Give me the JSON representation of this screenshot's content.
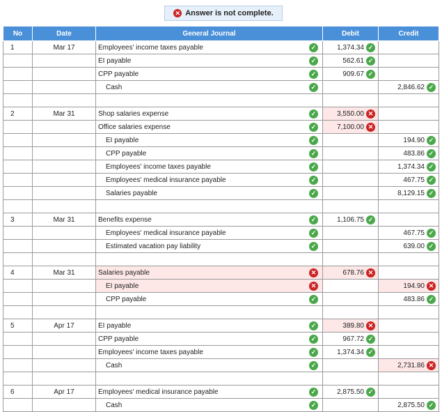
{
  "banner": "Answer is not complete.",
  "headers": [
    "No",
    "Date",
    "General Journal",
    "Debit",
    "Credit"
  ],
  "rows": [
    {
      "no": "1",
      "date": "Mar 17",
      "account": "Employees' income taxes payable",
      "indent": false,
      "acc_ok": true,
      "debit": "1,374.34",
      "debit_ok": true,
      "credit": "",
      "credit_ok": null
    },
    {
      "no": "",
      "date": "",
      "account": "EI payable",
      "indent": false,
      "acc_ok": true,
      "debit": "562.61",
      "debit_ok": true,
      "credit": "",
      "credit_ok": null
    },
    {
      "no": "",
      "date": "",
      "account": "CPP payable",
      "indent": false,
      "acc_ok": true,
      "debit": "909.67",
      "debit_ok": true,
      "credit": "",
      "credit_ok": null
    },
    {
      "no": "",
      "date": "",
      "account": "Cash",
      "indent": true,
      "acc_ok": true,
      "debit": "",
      "debit_ok": null,
      "credit": "2,846.62",
      "credit_ok": true
    },
    {
      "gap": true
    },
    {
      "no": "2",
      "date": "Mar 31",
      "account": "Shop salaries expense",
      "indent": false,
      "acc_ok": true,
      "debit": "3,550.00",
      "debit_ok": false,
      "credit": "",
      "credit_ok": null
    },
    {
      "no": "",
      "date": "",
      "account": "Office salaries expense",
      "indent": false,
      "acc_ok": true,
      "debit": "7,100.00",
      "debit_ok": false,
      "credit": "",
      "credit_ok": null
    },
    {
      "no": "",
      "date": "",
      "account": "EI payable",
      "indent": true,
      "acc_ok": true,
      "debit": "",
      "debit_ok": null,
      "credit": "194.90",
      "credit_ok": true
    },
    {
      "no": "",
      "date": "",
      "account": "CPP payable",
      "indent": true,
      "acc_ok": true,
      "debit": "",
      "debit_ok": null,
      "credit": "483.86",
      "credit_ok": true
    },
    {
      "no": "",
      "date": "",
      "account": "Employees' income taxes payable",
      "indent": true,
      "acc_ok": true,
      "debit": "",
      "debit_ok": null,
      "credit": "1,374.34",
      "credit_ok": true
    },
    {
      "no": "",
      "date": "",
      "account": "Employees' medical insurance payable",
      "indent": true,
      "acc_ok": true,
      "debit": "",
      "debit_ok": null,
      "credit": "467.75",
      "credit_ok": true
    },
    {
      "no": "",
      "date": "",
      "account": "Salaries payable",
      "indent": true,
      "acc_ok": true,
      "debit": "",
      "debit_ok": null,
      "credit": "8,129.15",
      "credit_ok": true
    },
    {
      "gap": true
    },
    {
      "no": "3",
      "date": "Mar 31",
      "account": "Benefits expense",
      "indent": false,
      "acc_ok": true,
      "debit": "1,106.75",
      "debit_ok": true,
      "credit": "",
      "credit_ok": null
    },
    {
      "no": "",
      "date": "",
      "account": "Employees' medical insurance payable",
      "indent": true,
      "acc_ok": true,
      "debit": "",
      "debit_ok": null,
      "credit": "467.75",
      "credit_ok": true
    },
    {
      "no": "",
      "date": "",
      "account": "Estimated vacation pay liability",
      "indent": true,
      "acc_ok": true,
      "debit": "",
      "debit_ok": null,
      "credit": "639.00",
      "credit_ok": true
    },
    {
      "gap": true
    },
    {
      "no": "4",
      "date": "Mar 31",
      "account": "Salaries payable",
      "indent": false,
      "acc_ok": false,
      "debit": "678.76",
      "debit_ok": false,
      "credit": "",
      "credit_ok": null
    },
    {
      "no": "",
      "date": "",
      "account": "EI payable",
      "indent": true,
      "acc_ok": false,
      "debit": "",
      "debit_ok": null,
      "credit": "194.90",
      "credit_ok": false
    },
    {
      "no": "",
      "date": "",
      "account": "CPP payable",
      "indent": true,
      "acc_ok": true,
      "debit": "",
      "debit_ok": null,
      "credit": "483.86",
      "credit_ok": true
    },
    {
      "gap": true
    },
    {
      "no": "5",
      "date": "Apr 17",
      "account": "EI payable",
      "indent": false,
      "acc_ok": true,
      "debit": "389.80",
      "debit_ok": false,
      "credit": "",
      "credit_ok": null
    },
    {
      "no": "",
      "date": "",
      "account": "CPP payable",
      "indent": false,
      "acc_ok": true,
      "debit": "967.72",
      "debit_ok": true,
      "credit": "",
      "credit_ok": null
    },
    {
      "no": "",
      "date": "",
      "account": "Employees' income taxes payable",
      "indent": false,
      "acc_ok": true,
      "debit": "1,374.34",
      "debit_ok": true,
      "credit": "",
      "credit_ok": null
    },
    {
      "no": "",
      "date": "",
      "account": "Cash",
      "indent": true,
      "acc_ok": true,
      "debit": "",
      "debit_ok": null,
      "credit": "2,731.86",
      "credit_ok": false
    },
    {
      "gap": true
    },
    {
      "no": "6",
      "date": "Apr 17",
      "account": "Employees' medical insurance payable",
      "indent": false,
      "acc_ok": true,
      "debit": "2,875.50",
      "debit_ok": true,
      "credit": "",
      "credit_ok": null
    },
    {
      "no": "",
      "date": "",
      "account": "Cash",
      "indent": true,
      "acc_ok": true,
      "debit": "",
      "debit_ok": null,
      "credit": "2,875.50",
      "credit_ok": true
    }
  ]
}
